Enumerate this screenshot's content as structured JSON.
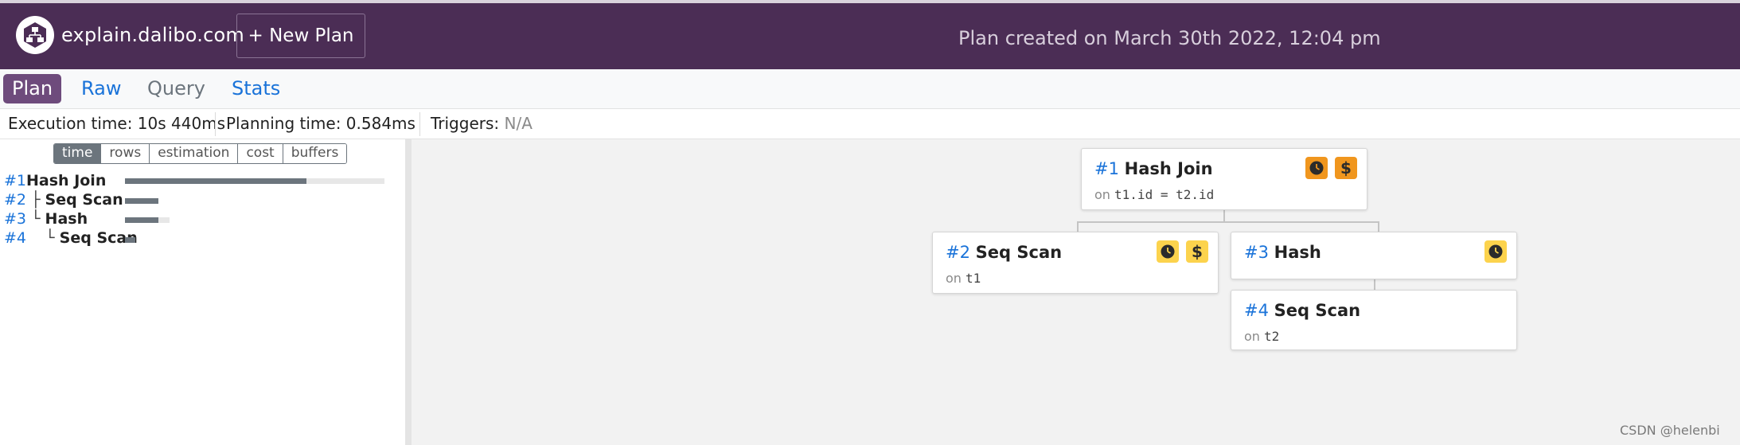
{
  "header": {
    "site_name": "explain.dalibo.com",
    "new_plan_label": "+ New Plan",
    "plan_created": "Plan created on March 30th 2022, 12:04 pm",
    "background_color": "#4b2d55"
  },
  "tabs": [
    {
      "label": "Plan",
      "active": true
    },
    {
      "label": "Raw",
      "active": false
    },
    {
      "label": "Query",
      "active": false
    },
    {
      "label": "Stats",
      "active": false
    }
  ],
  "stats": {
    "execution_label": "Execution time:",
    "execution_value": "10s 440ms",
    "planning_label": "Planning time:",
    "planning_value": "0.584ms",
    "triggers_label": "Triggers:",
    "triggers_value": "N/A"
  },
  "metric_buttons": [
    {
      "label": "time",
      "active": true
    },
    {
      "label": "rows",
      "active": false
    },
    {
      "label": "estimation",
      "active": false
    },
    {
      "label": "cost",
      "active": false
    },
    {
      "label": "buffers",
      "active": false
    }
  ],
  "tree": [
    {
      "num": "#1",
      "prefix": "",
      "name": "Hash Join",
      "time_fraction": 0.7
    },
    {
      "num": "#2",
      "prefix": "├ ",
      "name": "Seq Scan",
      "time_fraction": 0.13
    },
    {
      "num": "#3",
      "prefix": "└ ",
      "name": "Hash",
      "time_fraction": 0.13
    },
    {
      "num": "#4",
      "prefix": "  └ ",
      "name": "Seq Scan",
      "time_fraction": 0.04
    }
  ],
  "nodes": {
    "n1": {
      "num": "#1",
      "name": "Hash Join",
      "on_label": "on",
      "detail": "t1.id = t2.id",
      "badges": [
        "clock-orange",
        "dollar-orange"
      ]
    },
    "n2": {
      "num": "#2",
      "name": "Seq Scan",
      "on_label": "on",
      "detail": "t1",
      "badges": [
        "clock-yellow",
        "dollar-yellow"
      ]
    },
    "n3": {
      "num": "#3",
      "name": "Hash",
      "badges": [
        "clock-yellow"
      ]
    },
    "n4": {
      "num": "#4",
      "name": "Seq Scan",
      "on_label": "on",
      "detail": "t2",
      "badges": []
    }
  },
  "watermark": "CSDN @helenbi"
}
